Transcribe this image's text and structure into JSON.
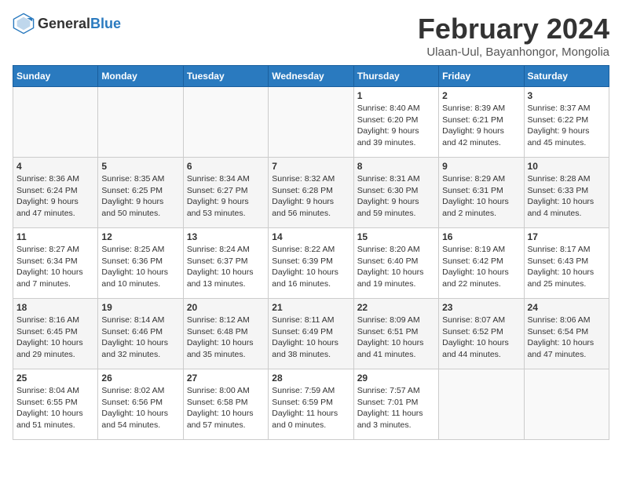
{
  "logo": {
    "general": "General",
    "blue": "Blue"
  },
  "title": {
    "month_year": "February 2024",
    "location": "Ulaan-Uul, Bayanhongor, Mongolia"
  },
  "columns": [
    "Sunday",
    "Monday",
    "Tuesday",
    "Wednesday",
    "Thursday",
    "Friday",
    "Saturday"
  ],
  "weeks": [
    [
      {
        "day": "",
        "info": ""
      },
      {
        "day": "",
        "info": ""
      },
      {
        "day": "",
        "info": ""
      },
      {
        "day": "",
        "info": ""
      },
      {
        "day": "1",
        "info": "Sunrise: 8:40 AM\nSunset: 6:20 PM\nDaylight: 9 hours\nand 39 minutes."
      },
      {
        "day": "2",
        "info": "Sunrise: 8:39 AM\nSunset: 6:21 PM\nDaylight: 9 hours\nand 42 minutes."
      },
      {
        "day": "3",
        "info": "Sunrise: 8:37 AM\nSunset: 6:22 PM\nDaylight: 9 hours\nand 45 minutes."
      }
    ],
    [
      {
        "day": "4",
        "info": "Sunrise: 8:36 AM\nSunset: 6:24 PM\nDaylight: 9 hours\nand 47 minutes."
      },
      {
        "day": "5",
        "info": "Sunrise: 8:35 AM\nSunset: 6:25 PM\nDaylight: 9 hours\nand 50 minutes."
      },
      {
        "day": "6",
        "info": "Sunrise: 8:34 AM\nSunset: 6:27 PM\nDaylight: 9 hours\nand 53 minutes."
      },
      {
        "day": "7",
        "info": "Sunrise: 8:32 AM\nSunset: 6:28 PM\nDaylight: 9 hours\nand 56 minutes."
      },
      {
        "day": "8",
        "info": "Sunrise: 8:31 AM\nSunset: 6:30 PM\nDaylight: 9 hours\nand 59 minutes."
      },
      {
        "day": "9",
        "info": "Sunrise: 8:29 AM\nSunset: 6:31 PM\nDaylight: 10 hours\nand 2 minutes."
      },
      {
        "day": "10",
        "info": "Sunrise: 8:28 AM\nSunset: 6:33 PM\nDaylight: 10 hours\nand 4 minutes."
      }
    ],
    [
      {
        "day": "11",
        "info": "Sunrise: 8:27 AM\nSunset: 6:34 PM\nDaylight: 10 hours\nand 7 minutes."
      },
      {
        "day": "12",
        "info": "Sunrise: 8:25 AM\nSunset: 6:36 PM\nDaylight: 10 hours\nand 10 minutes."
      },
      {
        "day": "13",
        "info": "Sunrise: 8:24 AM\nSunset: 6:37 PM\nDaylight: 10 hours\nand 13 minutes."
      },
      {
        "day": "14",
        "info": "Sunrise: 8:22 AM\nSunset: 6:39 PM\nDaylight: 10 hours\nand 16 minutes."
      },
      {
        "day": "15",
        "info": "Sunrise: 8:20 AM\nSunset: 6:40 PM\nDaylight: 10 hours\nand 19 minutes."
      },
      {
        "day": "16",
        "info": "Sunrise: 8:19 AM\nSunset: 6:42 PM\nDaylight: 10 hours\nand 22 minutes."
      },
      {
        "day": "17",
        "info": "Sunrise: 8:17 AM\nSunset: 6:43 PM\nDaylight: 10 hours\nand 25 minutes."
      }
    ],
    [
      {
        "day": "18",
        "info": "Sunrise: 8:16 AM\nSunset: 6:45 PM\nDaylight: 10 hours\nand 29 minutes."
      },
      {
        "day": "19",
        "info": "Sunrise: 8:14 AM\nSunset: 6:46 PM\nDaylight: 10 hours\nand 32 minutes."
      },
      {
        "day": "20",
        "info": "Sunrise: 8:12 AM\nSunset: 6:48 PM\nDaylight: 10 hours\nand 35 minutes."
      },
      {
        "day": "21",
        "info": "Sunrise: 8:11 AM\nSunset: 6:49 PM\nDaylight: 10 hours\nand 38 minutes."
      },
      {
        "day": "22",
        "info": "Sunrise: 8:09 AM\nSunset: 6:51 PM\nDaylight: 10 hours\nand 41 minutes."
      },
      {
        "day": "23",
        "info": "Sunrise: 8:07 AM\nSunset: 6:52 PM\nDaylight: 10 hours\nand 44 minutes."
      },
      {
        "day": "24",
        "info": "Sunrise: 8:06 AM\nSunset: 6:54 PM\nDaylight: 10 hours\nand 47 minutes."
      }
    ],
    [
      {
        "day": "25",
        "info": "Sunrise: 8:04 AM\nSunset: 6:55 PM\nDaylight: 10 hours\nand 51 minutes."
      },
      {
        "day": "26",
        "info": "Sunrise: 8:02 AM\nSunset: 6:56 PM\nDaylight: 10 hours\nand 54 minutes."
      },
      {
        "day": "27",
        "info": "Sunrise: 8:00 AM\nSunset: 6:58 PM\nDaylight: 10 hours\nand 57 minutes."
      },
      {
        "day": "28",
        "info": "Sunrise: 7:59 AM\nSunset: 6:59 PM\nDaylight: 11 hours\nand 0 minutes."
      },
      {
        "day": "29",
        "info": "Sunrise: 7:57 AM\nSunset: 7:01 PM\nDaylight: 11 hours\nand 3 minutes."
      },
      {
        "day": "",
        "info": ""
      },
      {
        "day": "",
        "info": ""
      }
    ]
  ]
}
